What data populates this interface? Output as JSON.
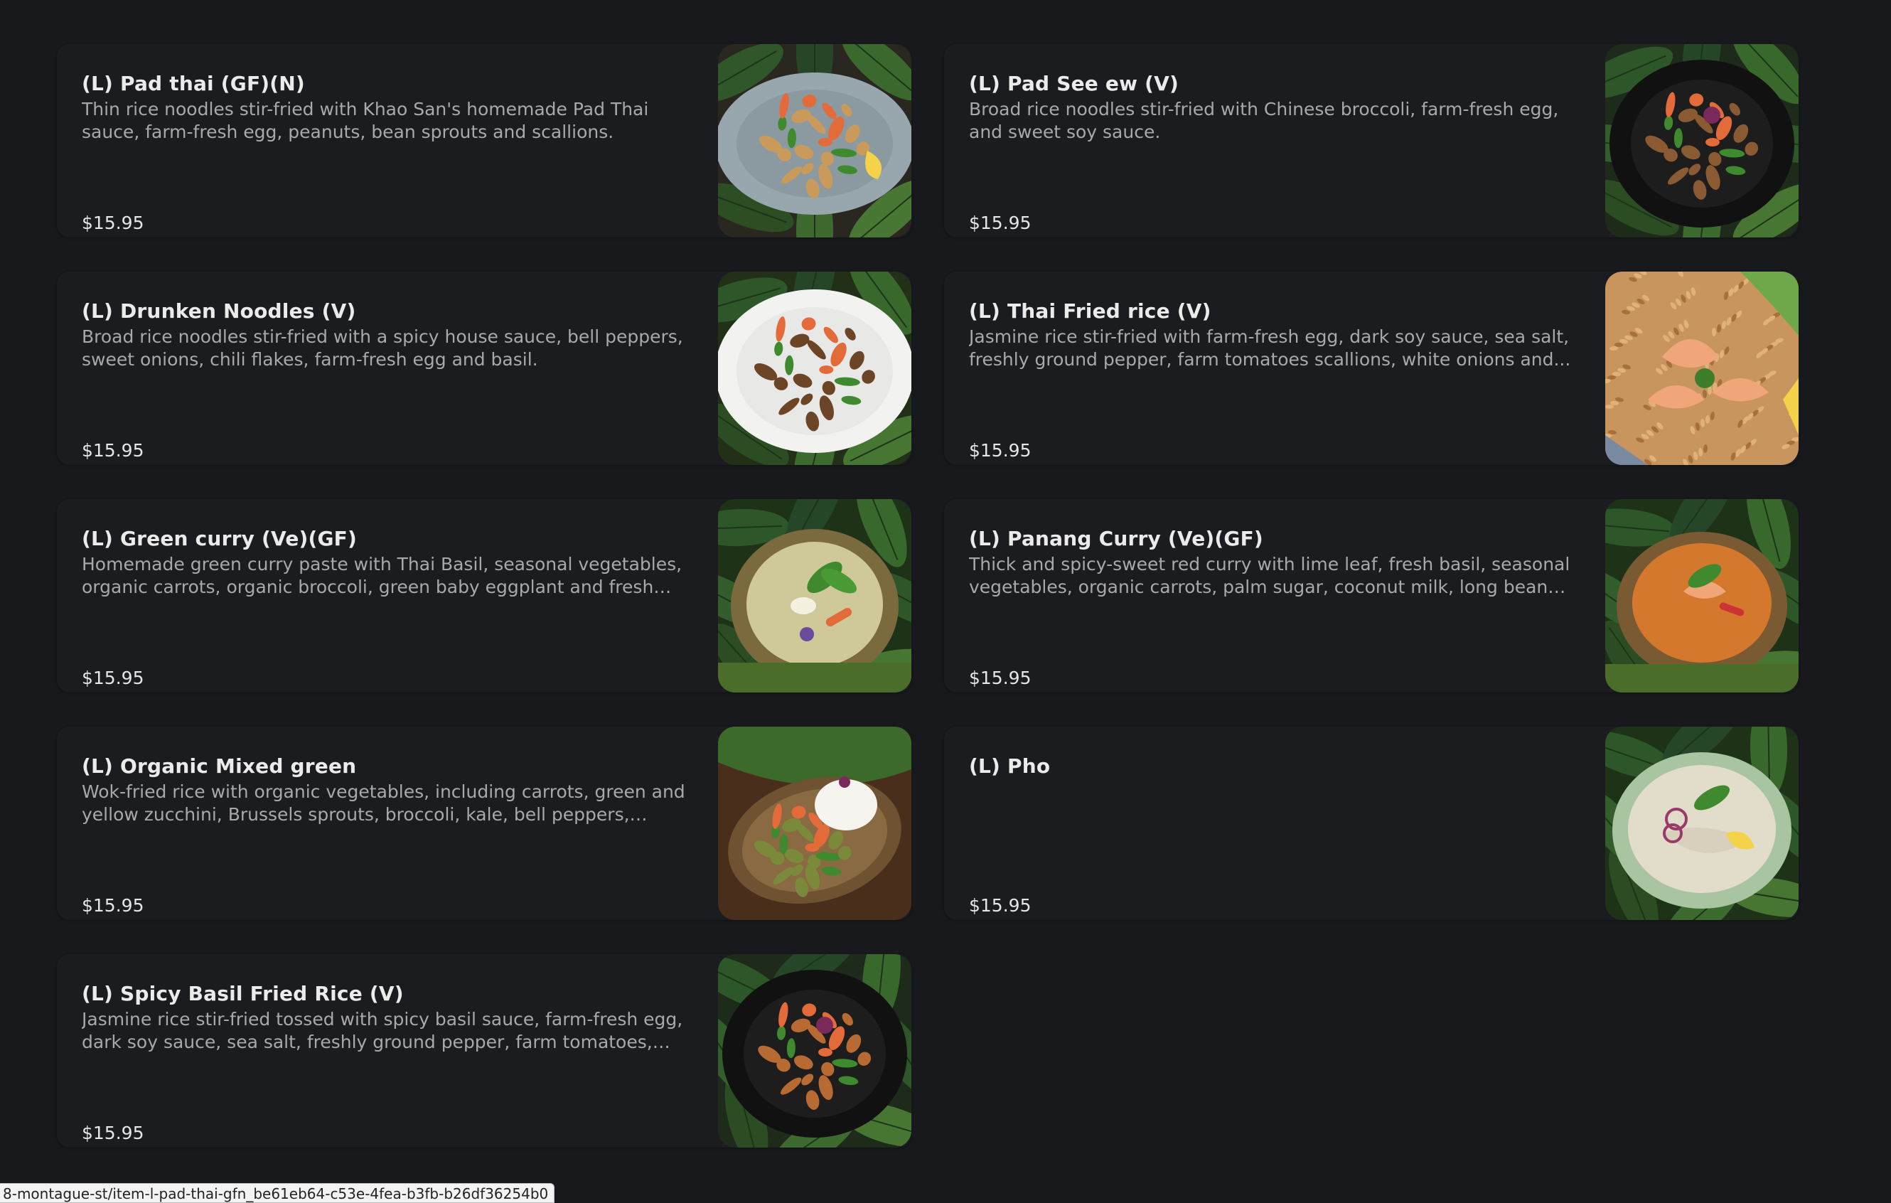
{
  "menu": {
    "items": [
      {
        "name": "(L) Pad thai (GF)(N)",
        "description": "Thin rice noodles stir-fried with Khao San's homemade Pad Thai sauce, farm-fresh egg, peanuts, bean sprouts and scallions.",
        "price": "$15.95",
        "plate": "grey-plate",
        "food_color": "#c99a5a"
      },
      {
        "name": "(L) Pad See ew (V)",
        "description": "Broad rice noodles stir-fried with Chinese broccoli, farm-fresh egg, and sweet soy sauce.",
        "price": "$15.95",
        "plate": "black-bowl",
        "food_color": "#8a5a32"
      },
      {
        "name": "(L) Drunken Noodles (V)",
        "description": "Broad rice noodles stir-fried with a spicy house sauce, bell peppers, sweet onions, chili flakes, farm-fresh egg and basil.",
        "price": "$15.95",
        "plate": "white-plate",
        "food_color": "#6b4526"
      },
      {
        "name": "(L) Thai Fried rice (V)",
        "description": "Jasmine rice stir-fried with farm-fresh egg, dark soy sauce, sea salt, freshly ground pepper, farm tomatoes scallions, white onions and...",
        "price": "$15.95",
        "plate": "rice-closeup",
        "food_color": "#c8955f"
      },
      {
        "name": "(L) Green curry (Ve)(GF)",
        "description": "Homemade green curry paste with Thai Basil, seasonal vegetables, organic carrots, organic broccoli, green baby eggplant and fresh basil...",
        "price": "$15.95",
        "plate": "green-curry-bowl",
        "food_color": "#cfc99a"
      },
      {
        "name": "(L) Panang Curry (Ve)(GF)",
        "description": "Thick and spicy-sweet red curry with lime leaf, fresh basil, seasonal vegetables, organic carrots, palm sugar, coconut milk, long beans and...",
        "price": "$15.95",
        "plate": "red-curry-bowl",
        "food_color": "#d4782e"
      },
      {
        "name": "(L) Organic Mixed green",
        "description": "Wok-fried rice with organic vegetables, including carrots, green and yellow zucchini, Brussels sprouts, broccoli, kale, bell peppers, organic...",
        "price": "$15.95",
        "plate": "oval-dish",
        "food_color": "#7a8a3a"
      },
      {
        "name": "(L) Pho",
        "description": "",
        "price": "$15.95",
        "plate": "pho-bowl",
        "food_color": "#e2dccb"
      },
      {
        "name": "(L) Spicy Basil Fried Rice (V)",
        "description": "Jasmine rice stir-fried tossed with spicy basil sauce, farm-fresh egg, dark soy sauce, sea salt, freshly ground pepper, farm tomatoes, bell...",
        "price": "$15.95",
        "plate": "black-bowl",
        "food_color": "#b86a33"
      }
    ]
  },
  "status_bar": {
    "url": "8-montague-st/item-l-pad-thai-gfn_be61eb64-c53e-4fea-b3fb-b26df36254b0"
  }
}
